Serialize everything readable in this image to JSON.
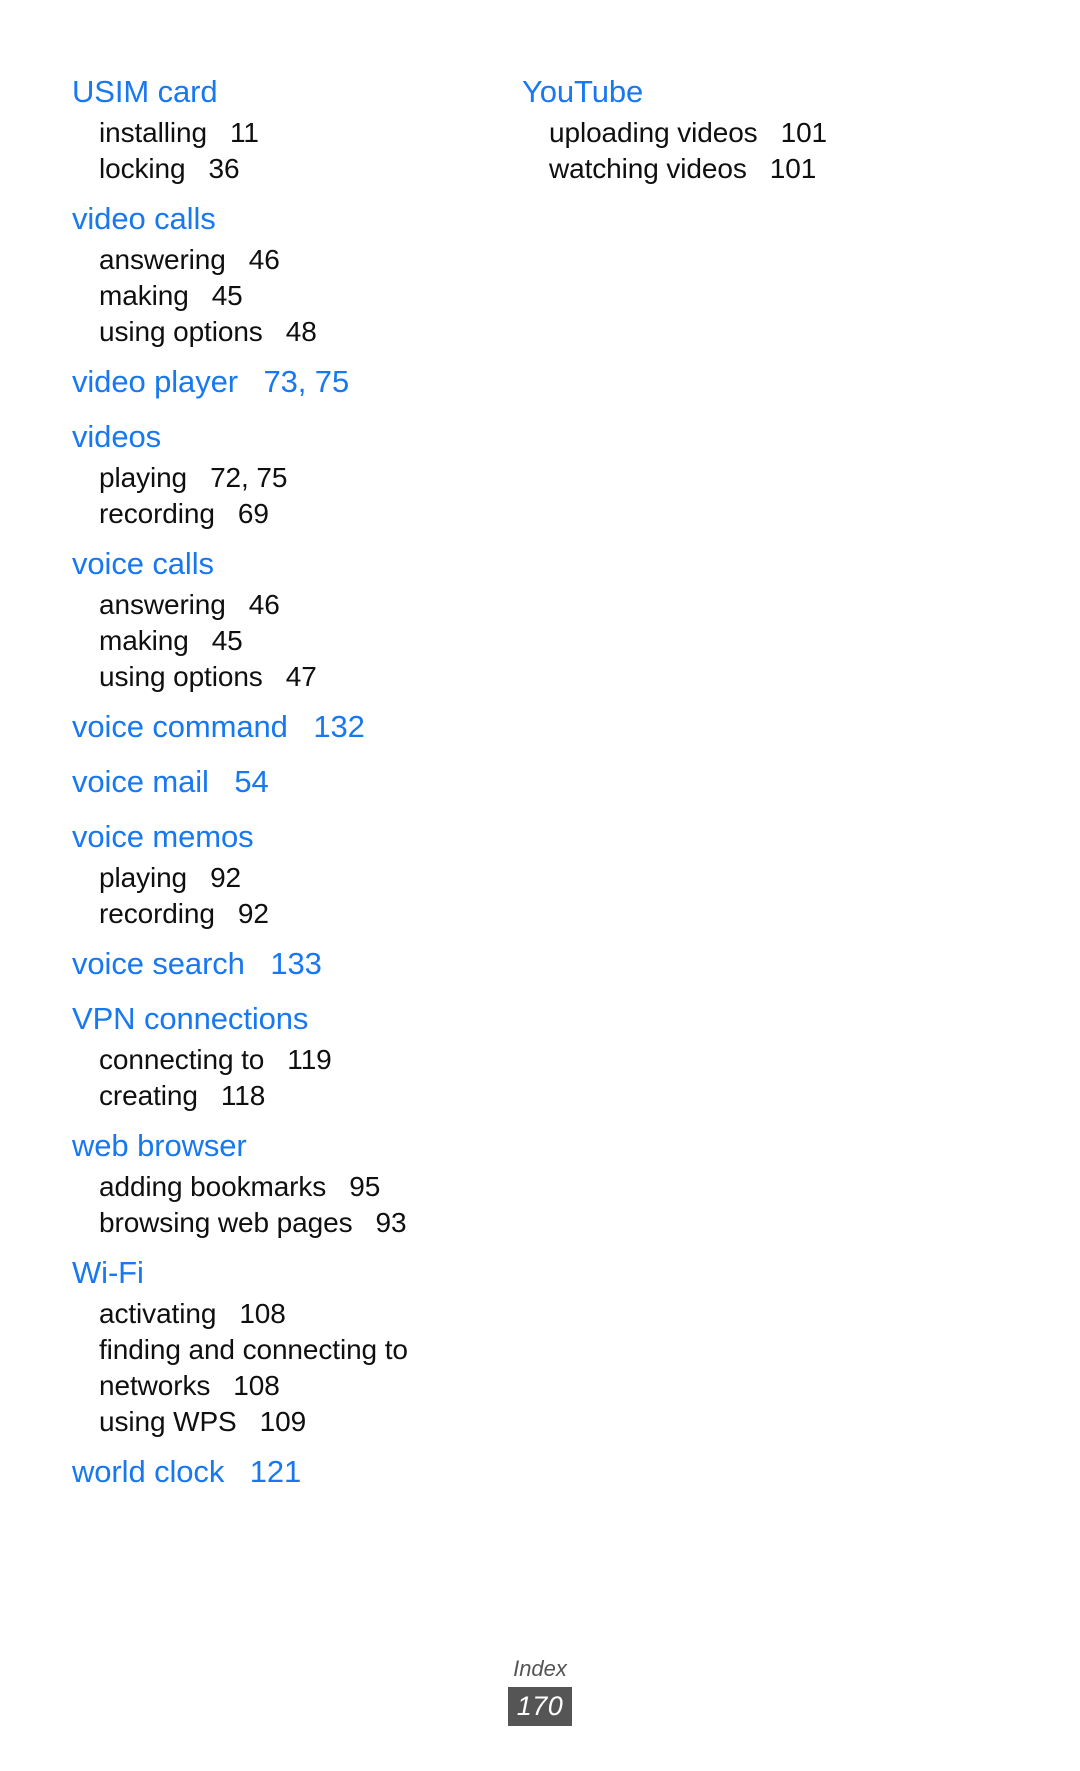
{
  "document": {
    "type": "index",
    "footer_label": "Index",
    "page_number": "170",
    "accent_color": "#1878f0",
    "body_color": "#0f0f0f",
    "footer_color": "#555555"
  },
  "columns": [
    {
      "name": "left-column",
      "entries": [
        {
          "term": "USIM card",
          "pages": "",
          "subentries": [
            {
              "label": "installing",
              "pages": "11"
            },
            {
              "label": "locking",
              "pages": "36"
            }
          ]
        },
        {
          "term": "video calls",
          "pages": "",
          "subentries": [
            {
              "label": "answering",
              "pages": "46"
            },
            {
              "label": "making",
              "pages": "45"
            },
            {
              "label": "using options",
              "pages": "48"
            }
          ]
        },
        {
          "term": "video player",
          "pages": "73, 75",
          "subentries": []
        },
        {
          "term": "videos",
          "pages": "",
          "subentries": [
            {
              "label": "playing",
              "pages": "72, 75"
            },
            {
              "label": "recording",
              "pages": "69"
            }
          ]
        },
        {
          "term": "voice calls",
          "pages": "",
          "subentries": [
            {
              "label": "answering",
              "pages": "46"
            },
            {
              "label": "making",
              "pages": "45"
            },
            {
              "label": "using options",
              "pages": "47"
            }
          ]
        },
        {
          "term": "voice command",
          "pages": "132",
          "subentries": []
        },
        {
          "term": "voice mail",
          "pages": "54",
          "subentries": []
        },
        {
          "term": "voice memos",
          "pages": "",
          "subentries": [
            {
              "label": "playing",
              "pages": "92"
            },
            {
              "label": "recording",
              "pages": "92"
            }
          ]
        },
        {
          "term": "voice search",
          "pages": "133",
          "subentries": []
        },
        {
          "term": "VPN connections",
          "pages": "",
          "subentries": [
            {
              "label": "connecting to",
              "pages": "119"
            },
            {
              "label": "creating",
              "pages": "118"
            }
          ]
        },
        {
          "term": "web browser",
          "pages": "",
          "subentries": [
            {
              "label": "adding bookmarks",
              "pages": "95"
            },
            {
              "label": "browsing web pages",
              "pages": "93"
            }
          ]
        },
        {
          "term": "Wi-Fi",
          "pages": "",
          "subentries": [
            {
              "label": "activating",
              "pages": "108"
            },
            {
              "label": "finding and connecting to networks",
              "pages": "108"
            },
            {
              "label": "using WPS",
              "pages": "109"
            }
          ]
        },
        {
          "term": "world clock",
          "pages": "121",
          "subentries": []
        }
      ]
    },
    {
      "name": "right-column",
      "entries": [
        {
          "term": "YouTube",
          "pages": "",
          "subentries": [
            {
              "label": "uploading videos",
              "pages": "101"
            },
            {
              "label": "watching videos",
              "pages": "101"
            }
          ]
        }
      ]
    }
  ]
}
